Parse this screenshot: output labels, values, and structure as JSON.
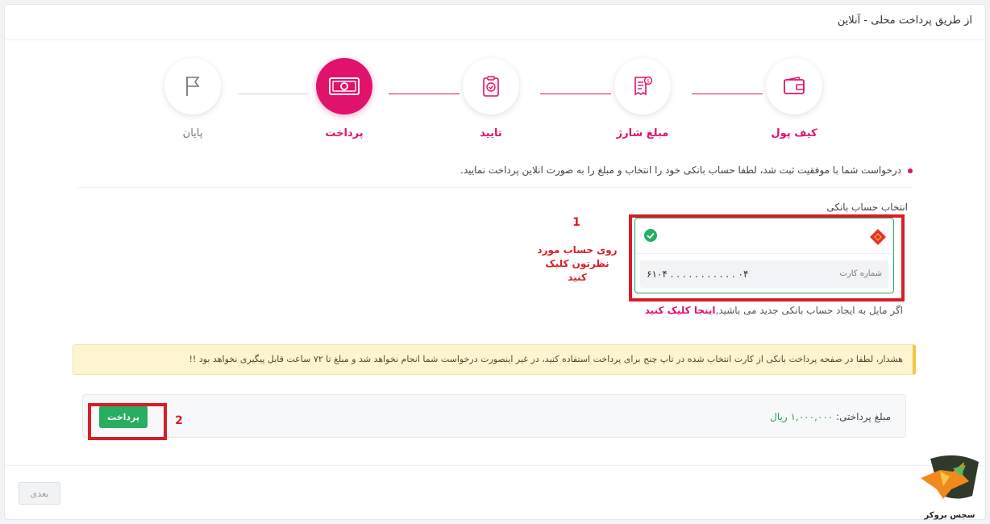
{
  "header": {
    "title": "از طریق پرداخت محلی - آنلاین"
  },
  "steps": [
    {
      "label": "کیف پول",
      "icon": "wallet-icon",
      "state": "done"
    },
    {
      "label": "مبلغ شارژ",
      "icon": "invoice-icon",
      "state": "done"
    },
    {
      "label": "تایید",
      "icon": "clipboard-check-icon",
      "state": "done"
    },
    {
      "label": "پرداخت",
      "icon": "banknote-icon",
      "state": "active"
    },
    {
      "label": "پایان",
      "icon": "flag-icon",
      "state": "todo"
    }
  ],
  "info": {
    "text": "درخواست شما با موفقیت ثبت شد، لطفا حساب بانکی خود را انتخاب و مبلغ را به صورت انلاین پرداخت نمایید."
  },
  "bank_section": {
    "title": "انتخاب حساب بانکی",
    "card": {
      "number_label": "شماره کارت",
      "number_masked": "۶۱۰۴ . . . . . . . . . . . ۰۴",
      "selected": true
    },
    "create_prefix": "اگر مایل به ایجاد حساب بانکی جدید می باشید,",
    "create_link": "اینجا کلیک کنید"
  },
  "annotations": {
    "one_number": "1",
    "one_text": "روی حساب مورد نظرتون کلیک کنید",
    "two_number": "2"
  },
  "warning": {
    "text": "هشدار، لطفا در صفحه پرداخت بانکی از کارت انتخاب شده در تاپ چنج برای پرداخت استفاده کنید، در غیر اینصورت درخواست شما انجام نخواهد شد و مبلغ تا ۷۲ ساعت قابل پیگیری نخواهد بود !!"
  },
  "payment": {
    "amount_label": "مبلغ پرداختی:",
    "amount_value": "۱,۰۰۰,۰۰۰ ریال",
    "pay_button": "پرداخت"
  },
  "footer": {
    "next_button": "بعدی"
  },
  "watermark": {
    "text": "سجس بروکر"
  },
  "colors": {
    "accent": "#e0126c",
    "success": "#27ae60",
    "annotation": "#d71e26",
    "warning_bg": "#fdf4d2"
  }
}
